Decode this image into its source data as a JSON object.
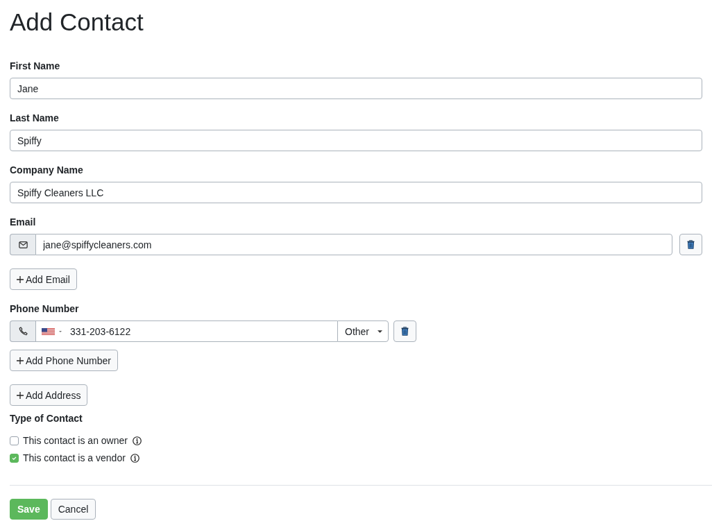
{
  "title": "Add Contact",
  "fields": [
    {
      "label": "First Name",
      "value": "Jane"
    },
    {
      "label": "Last Name",
      "value": "Spiffy"
    },
    {
      "label": "Company Name",
      "value": "Spiffy Cleaners LLC"
    }
  ],
  "email": {
    "label": "Email",
    "entries": [
      {
        "value": "jane@spiffycleaners.com"
      }
    ],
    "add_button": "Add Email"
  },
  "phone": {
    "label": "Phone Number",
    "entries": [
      {
        "number": "331-203-6122",
        "type": "Other"
      }
    ],
    "add_button": "Add Phone Number"
  },
  "add_address_button": "Add Address",
  "contact_type": {
    "label": "Type of Contact",
    "options": [
      {
        "label": "This contact is an owner",
        "checked": false
      },
      {
        "label": "This contact is a vendor",
        "checked": true
      }
    ]
  },
  "actions": [
    {
      "label": "Save",
      "kind": "primary"
    },
    {
      "label": "Cancel",
      "kind": "secondary"
    }
  ]
}
